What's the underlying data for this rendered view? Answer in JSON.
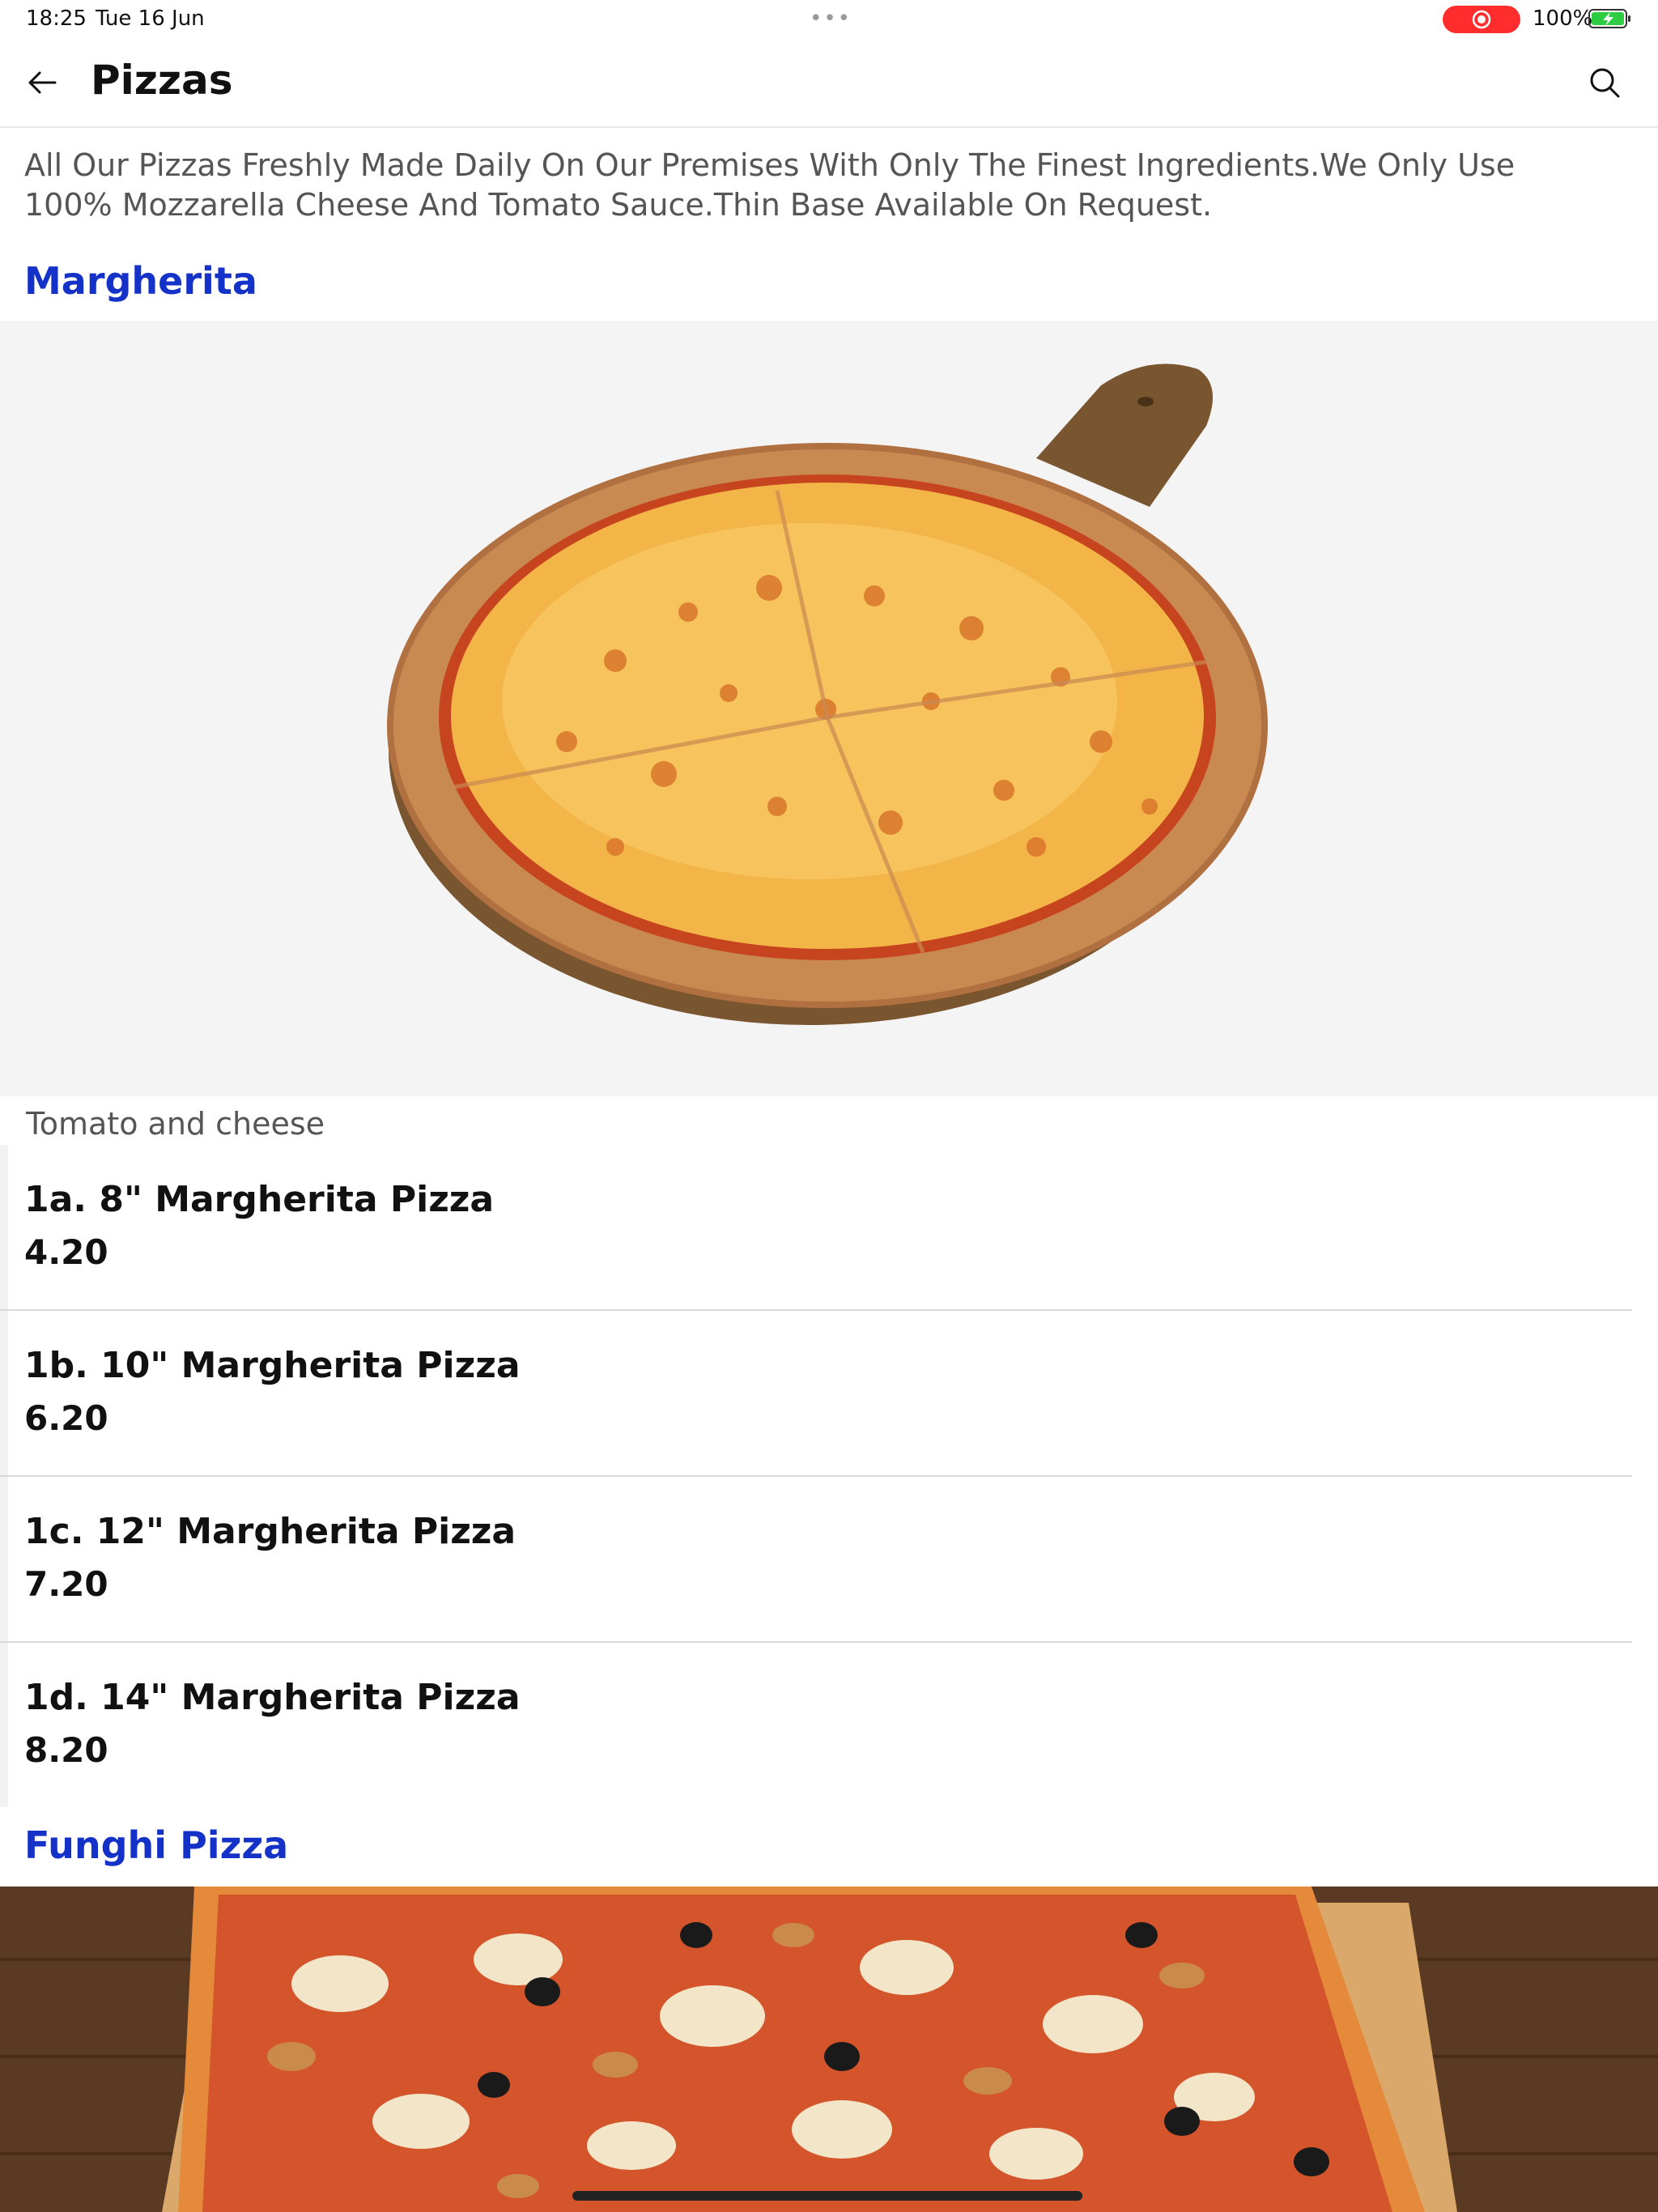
{
  "status_bar": {
    "time": "18:25",
    "date": "Tue 16 Jun",
    "dots": "•••",
    "battery": "100%",
    "recording_color": "#ff2d2d",
    "battery_color": "#2ecc40"
  },
  "nav": {
    "title": "Pizzas",
    "back_icon": "arrow-left-icon",
    "search_icon": "search-icon"
  },
  "intro": "All Our Pizzas Freshly Made Daily On Our Premises With Only The Finest Ingredients.We Only Use 100% Mozzarella Cheese And Tomato Sauce.Thin Base Available On Request.",
  "accent_color": "#1532c8",
  "sections": [
    {
      "title": "Margherita",
      "description": "Tomato and cheese",
      "items": [
        {
          "name": "1a. 8\" Margherita Pizza",
          "price": "4.20"
        },
        {
          "name": "1b. 10\" Margherita Pizza",
          "price": "6.20"
        },
        {
          "name": "1c. 12\" Margherita Pizza",
          "price": "7.20"
        },
        {
          "name": "1d. 14\" Margherita Pizza",
          "price": "8.20"
        }
      ]
    },
    {
      "title": "Funghi Pizza"
    }
  ]
}
